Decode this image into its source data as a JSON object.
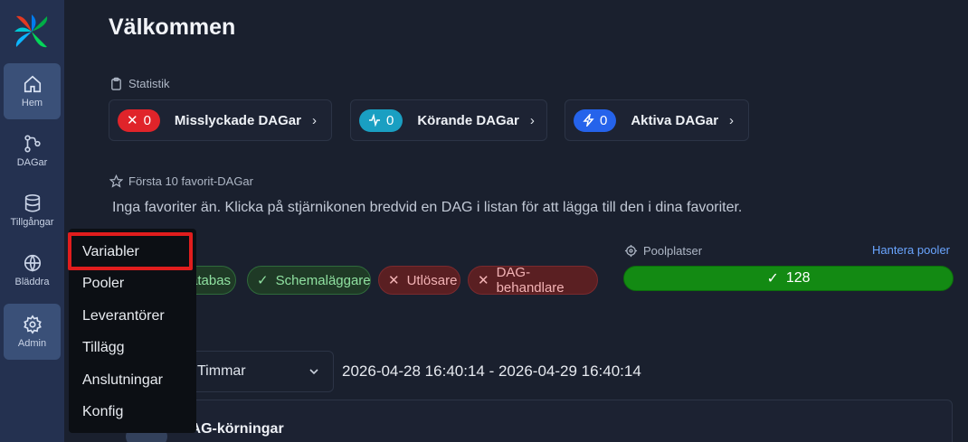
{
  "sidebar": {
    "items": [
      {
        "label": "Hem",
        "icon": "home-icon"
      },
      {
        "label": "DAGar",
        "icon": "dags-icon"
      },
      {
        "label": "Tillgångar",
        "icon": "database-icon"
      },
      {
        "label": "Bläddra",
        "icon": "globe-icon"
      },
      {
        "label": "Admin",
        "icon": "gear-icon"
      }
    ]
  },
  "main": {
    "title": "Välkommen",
    "stats_label": "Statistik",
    "stats": [
      {
        "count": "0",
        "label": "Misslyckade DAGar",
        "color": "#e0242a",
        "icon": "x-icon"
      },
      {
        "count": "0",
        "label": "Körande DAGar",
        "color": "#1a9fc2",
        "icon": "activity-icon"
      },
      {
        "count": "0",
        "label": "Aktiva DAGar",
        "color": "#2563eb",
        "icon": "lightning-icon"
      }
    ],
    "favorites_label": "Första 10 favorit-DAGar",
    "favorites_empty": "Inga favoriter än. Klicka på stjärnikonen bredvid en DAG i listan för att lägga till den i dina favoriter.",
    "health": [
      {
        "label": "Metadatabas",
        "visible_label": "atabas",
        "status": "ok"
      },
      {
        "label": "Schemaläggare",
        "status": "ok"
      },
      {
        "label": "Utlösare",
        "status": "bad"
      },
      {
        "label": "DAG-behandlare",
        "status": "bad"
      }
    ],
    "pool_label": "Poolplatser",
    "pool_link": "Hantera pooler",
    "pool_slots": "128",
    "time_select": "Timmar",
    "time_range": "2026-04-28 16:40:14 - 2026-04-29 16:40:14",
    "runs_title": "DAG-körningar"
  },
  "menu": {
    "items": [
      "Variabler",
      "Pooler",
      "Leverantörer",
      "Tillägg",
      "Anslutningar",
      "Konfig"
    ],
    "highlighted": "Variabler"
  }
}
